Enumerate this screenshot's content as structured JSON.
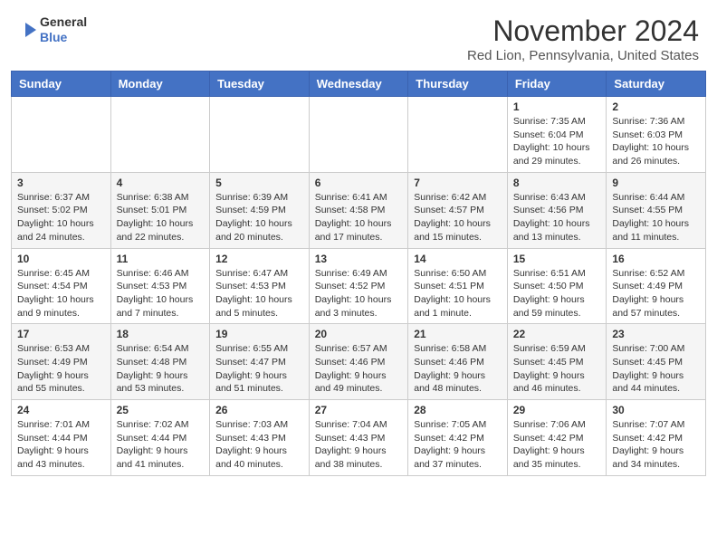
{
  "header": {
    "logo_line1": "General",
    "logo_line2": "Blue",
    "month_title": "November 2024",
    "location": "Red Lion, Pennsylvania, United States"
  },
  "weekdays": [
    "Sunday",
    "Monday",
    "Tuesday",
    "Wednesday",
    "Thursday",
    "Friday",
    "Saturday"
  ],
  "weeks": [
    [
      {
        "day": "",
        "info": ""
      },
      {
        "day": "",
        "info": ""
      },
      {
        "day": "",
        "info": ""
      },
      {
        "day": "",
        "info": ""
      },
      {
        "day": "",
        "info": ""
      },
      {
        "day": "1",
        "info": "Sunrise: 7:35 AM\nSunset: 6:04 PM\nDaylight: 10 hours and 29 minutes."
      },
      {
        "day": "2",
        "info": "Sunrise: 7:36 AM\nSunset: 6:03 PM\nDaylight: 10 hours and 26 minutes."
      }
    ],
    [
      {
        "day": "3",
        "info": "Sunrise: 6:37 AM\nSunset: 5:02 PM\nDaylight: 10 hours and 24 minutes."
      },
      {
        "day": "4",
        "info": "Sunrise: 6:38 AM\nSunset: 5:01 PM\nDaylight: 10 hours and 22 minutes."
      },
      {
        "day": "5",
        "info": "Sunrise: 6:39 AM\nSunset: 4:59 PM\nDaylight: 10 hours and 20 minutes."
      },
      {
        "day": "6",
        "info": "Sunrise: 6:41 AM\nSunset: 4:58 PM\nDaylight: 10 hours and 17 minutes."
      },
      {
        "day": "7",
        "info": "Sunrise: 6:42 AM\nSunset: 4:57 PM\nDaylight: 10 hours and 15 minutes."
      },
      {
        "day": "8",
        "info": "Sunrise: 6:43 AM\nSunset: 4:56 PM\nDaylight: 10 hours and 13 minutes."
      },
      {
        "day": "9",
        "info": "Sunrise: 6:44 AM\nSunset: 4:55 PM\nDaylight: 10 hours and 11 minutes."
      }
    ],
    [
      {
        "day": "10",
        "info": "Sunrise: 6:45 AM\nSunset: 4:54 PM\nDaylight: 10 hours and 9 minutes."
      },
      {
        "day": "11",
        "info": "Sunrise: 6:46 AM\nSunset: 4:53 PM\nDaylight: 10 hours and 7 minutes."
      },
      {
        "day": "12",
        "info": "Sunrise: 6:47 AM\nSunset: 4:53 PM\nDaylight: 10 hours and 5 minutes."
      },
      {
        "day": "13",
        "info": "Sunrise: 6:49 AM\nSunset: 4:52 PM\nDaylight: 10 hours and 3 minutes."
      },
      {
        "day": "14",
        "info": "Sunrise: 6:50 AM\nSunset: 4:51 PM\nDaylight: 10 hours and 1 minute."
      },
      {
        "day": "15",
        "info": "Sunrise: 6:51 AM\nSunset: 4:50 PM\nDaylight: 9 hours and 59 minutes."
      },
      {
        "day": "16",
        "info": "Sunrise: 6:52 AM\nSunset: 4:49 PM\nDaylight: 9 hours and 57 minutes."
      }
    ],
    [
      {
        "day": "17",
        "info": "Sunrise: 6:53 AM\nSunset: 4:49 PM\nDaylight: 9 hours and 55 minutes."
      },
      {
        "day": "18",
        "info": "Sunrise: 6:54 AM\nSunset: 4:48 PM\nDaylight: 9 hours and 53 minutes."
      },
      {
        "day": "19",
        "info": "Sunrise: 6:55 AM\nSunset: 4:47 PM\nDaylight: 9 hours and 51 minutes."
      },
      {
        "day": "20",
        "info": "Sunrise: 6:57 AM\nSunset: 4:46 PM\nDaylight: 9 hours and 49 minutes."
      },
      {
        "day": "21",
        "info": "Sunrise: 6:58 AM\nSunset: 4:46 PM\nDaylight: 9 hours and 48 minutes."
      },
      {
        "day": "22",
        "info": "Sunrise: 6:59 AM\nSunset: 4:45 PM\nDaylight: 9 hours and 46 minutes."
      },
      {
        "day": "23",
        "info": "Sunrise: 7:00 AM\nSunset: 4:45 PM\nDaylight: 9 hours and 44 minutes."
      }
    ],
    [
      {
        "day": "24",
        "info": "Sunrise: 7:01 AM\nSunset: 4:44 PM\nDaylight: 9 hours and 43 minutes."
      },
      {
        "day": "25",
        "info": "Sunrise: 7:02 AM\nSunset: 4:44 PM\nDaylight: 9 hours and 41 minutes."
      },
      {
        "day": "26",
        "info": "Sunrise: 7:03 AM\nSunset: 4:43 PM\nDaylight: 9 hours and 40 minutes."
      },
      {
        "day": "27",
        "info": "Sunrise: 7:04 AM\nSunset: 4:43 PM\nDaylight: 9 hours and 38 minutes."
      },
      {
        "day": "28",
        "info": "Sunrise: 7:05 AM\nSunset: 4:42 PM\nDaylight: 9 hours and 37 minutes."
      },
      {
        "day": "29",
        "info": "Sunrise: 7:06 AM\nSunset: 4:42 PM\nDaylight: 9 hours and 35 minutes."
      },
      {
        "day": "30",
        "info": "Sunrise: 7:07 AM\nSunset: 4:42 PM\nDaylight: 9 hours and 34 minutes."
      }
    ]
  ]
}
